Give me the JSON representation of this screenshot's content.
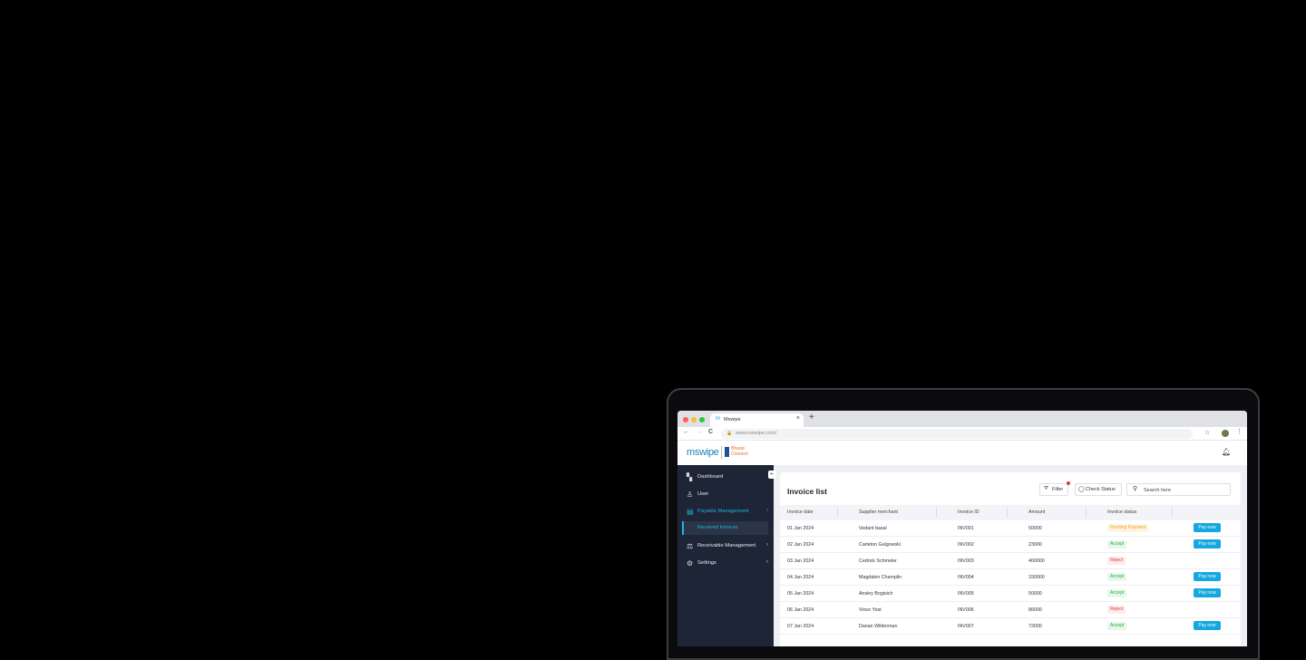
{
  "browser": {
    "tab_favicon": "m",
    "tab_title": "Mswipe",
    "tab_close": "×",
    "new_tab": "+",
    "back": "←",
    "forward": "→",
    "reload": "C",
    "url": "www.mswipe.com/",
    "bookmark": "☆",
    "menu": "⋮"
  },
  "header": {
    "logo_text": "mswipe",
    "partner_line1": "Bharat",
    "partner_line2": "Connect",
    "notification_icon": "bell-icon"
  },
  "sidebar": {
    "collapse": "⇤",
    "items": [
      {
        "label": "Dashboard",
        "icon": "▚"
      },
      {
        "label": "User",
        "icon": "♙"
      },
      {
        "label": "Payable Management",
        "icon": "▤",
        "chevron": "›"
      },
      {
        "label": "Receivable Management",
        "icon": "⚖",
        "chevron": "›"
      },
      {
        "label": "Settings",
        "icon": "⚙",
        "chevron": "›"
      }
    ],
    "sub_item": "Received Invoices"
  },
  "main": {
    "title": "Invoice list",
    "filter_label": "Filter",
    "check_status_label": "Check Status",
    "search_placeholder": "Search here",
    "columns": [
      "Invoice date",
      "Supplier merchant",
      "Invoice ID",
      "Amount",
      "Invoice status"
    ],
    "pay_label": "Pay now",
    "rows": [
      {
        "date": "01 Jan 2024",
        "merchant": "Vedant basal",
        "id": "INV001",
        "amount": "50000",
        "status": "Pending Payment",
        "pay": "Pay now"
      },
      {
        "date": "02 Jan 2024",
        "merchant": "Carleton Gulgowski",
        "id": "INV002",
        "amount": "23000",
        "status": "Accept",
        "pay": "Pay now"
      },
      {
        "date": "03 Jan 2024",
        "merchant": "Cedrick Schmeler",
        "id": "INV003",
        "amount": "460000",
        "status": "Reject",
        "pay": ""
      },
      {
        "date": "04 Jan 2024",
        "merchant": "Magdalen Champlin",
        "id": "INV004",
        "amount": "150000",
        "status": "Accept",
        "pay": "Pay now"
      },
      {
        "date": "05 Jan 2024",
        "merchant": "Ansley Bogisich",
        "id": "INV005",
        "amount": "50000",
        "status": "Accept",
        "pay": "Pay now"
      },
      {
        "date": "06 Jan 2024",
        "merchant": "Vince Yost",
        "id": "INV006",
        "amount": "86000",
        "status": "Reject",
        "pay": ""
      },
      {
        "date": "07 Jan 2024",
        "merchant": "Darian Wilderman",
        "id": "INV007",
        "amount": "72000",
        "status": "Accept",
        "pay": "Pay now"
      }
    ]
  },
  "colors": {
    "accent": "#13a8e0",
    "sidebar_bg": "#1e2536",
    "pending_bg": "#fff4e0",
    "pending_fg": "#f0a030",
    "accept_bg": "#e7f8e9",
    "accept_fg": "#2fa84f",
    "reject_bg": "#fdecec",
    "reject_fg": "#e23b3b"
  }
}
